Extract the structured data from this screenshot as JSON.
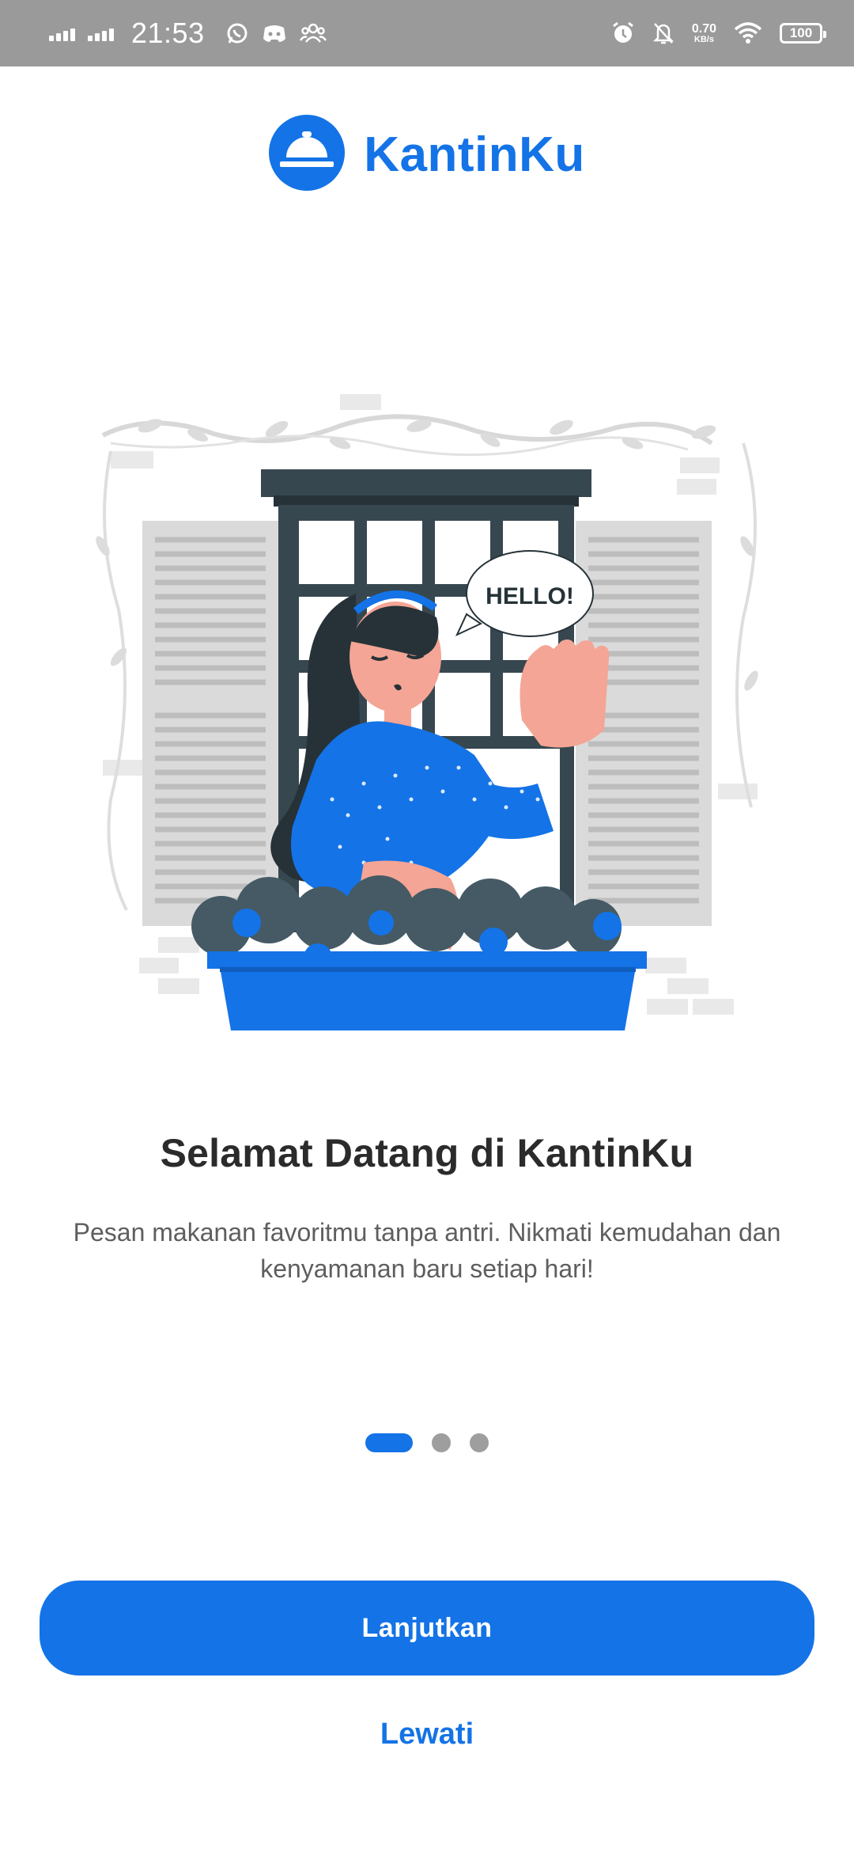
{
  "status_bar": {
    "time": "21:53",
    "net_speed_value": "0.70",
    "net_speed_unit": "KB/s",
    "battery": "100"
  },
  "brand": {
    "name": "KantinKu"
  },
  "illustration": {
    "speech_text": "HELLO!"
  },
  "onboarding": {
    "title": "Selamat Datang di KantinKu",
    "description": "Pesan makanan favoritmu tanpa antri. Nikmati kemudahan dan kenyamanan baru setiap hari!",
    "current_page": 1,
    "total_pages": 3
  },
  "actions": {
    "continue_label": "Lanjutkan",
    "skip_label": "Lewati"
  },
  "colors": {
    "accent": "#1473e6",
    "status_bar": "#9a9a9a",
    "title_text": "#2b2b2b",
    "body_text": "#5e5e5e"
  }
}
